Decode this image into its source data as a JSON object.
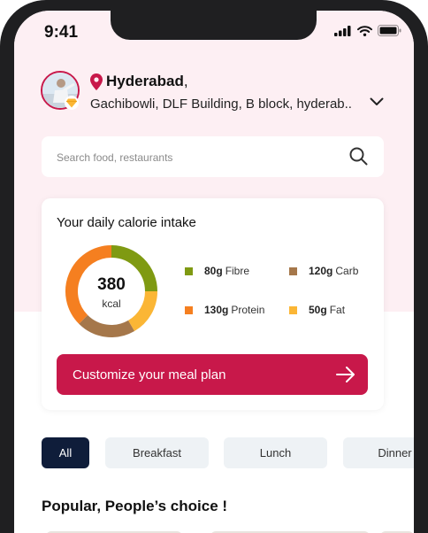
{
  "status_bar": {
    "time": "9:41"
  },
  "location": {
    "city": "Hyderabad",
    "city_suffix": ",",
    "address": "Gachibowli, DLF Building, B block, hyderab.."
  },
  "search": {
    "placeholder": "Search food, restaurants"
  },
  "calorie_card": {
    "title": "Your daily calorie intake",
    "kcal_value": "380",
    "kcal_unit": "kcal",
    "macros": [
      {
        "value": "80g",
        "label": "Fibre",
        "color": "#7f9a12"
      },
      {
        "value": "120g",
        "label": "Carb",
        "color": "#a5774a"
      },
      {
        "value": "130g",
        "label": "Protein",
        "color": "#f57f20"
      },
      {
        "value": "50g",
        "label": "Fat",
        "color": "#fbb635"
      }
    ],
    "cta_label": "Customize your meal plan"
  },
  "chart_data": {
    "type": "pie",
    "categories": [
      "Fibre",
      "Fat",
      "Carb",
      "Protein"
    ],
    "values": [
      90,
      60,
      75,
      135
    ],
    "unit": "degrees of ring",
    "center_value": "380",
    "center_unit": "kcal"
  },
  "meal_tabs": [
    {
      "label": "All",
      "active": true
    },
    {
      "label": "Breakfast",
      "active": false
    },
    {
      "label": "Lunch",
      "active": false
    },
    {
      "label": "Dinner",
      "active": false
    }
  ],
  "section": {
    "title": "Popular, People’s choice !"
  },
  "colors": {
    "brand": "#c8184a",
    "active_chip": "#0f1d3a",
    "header_bg": "#fdeff3"
  }
}
